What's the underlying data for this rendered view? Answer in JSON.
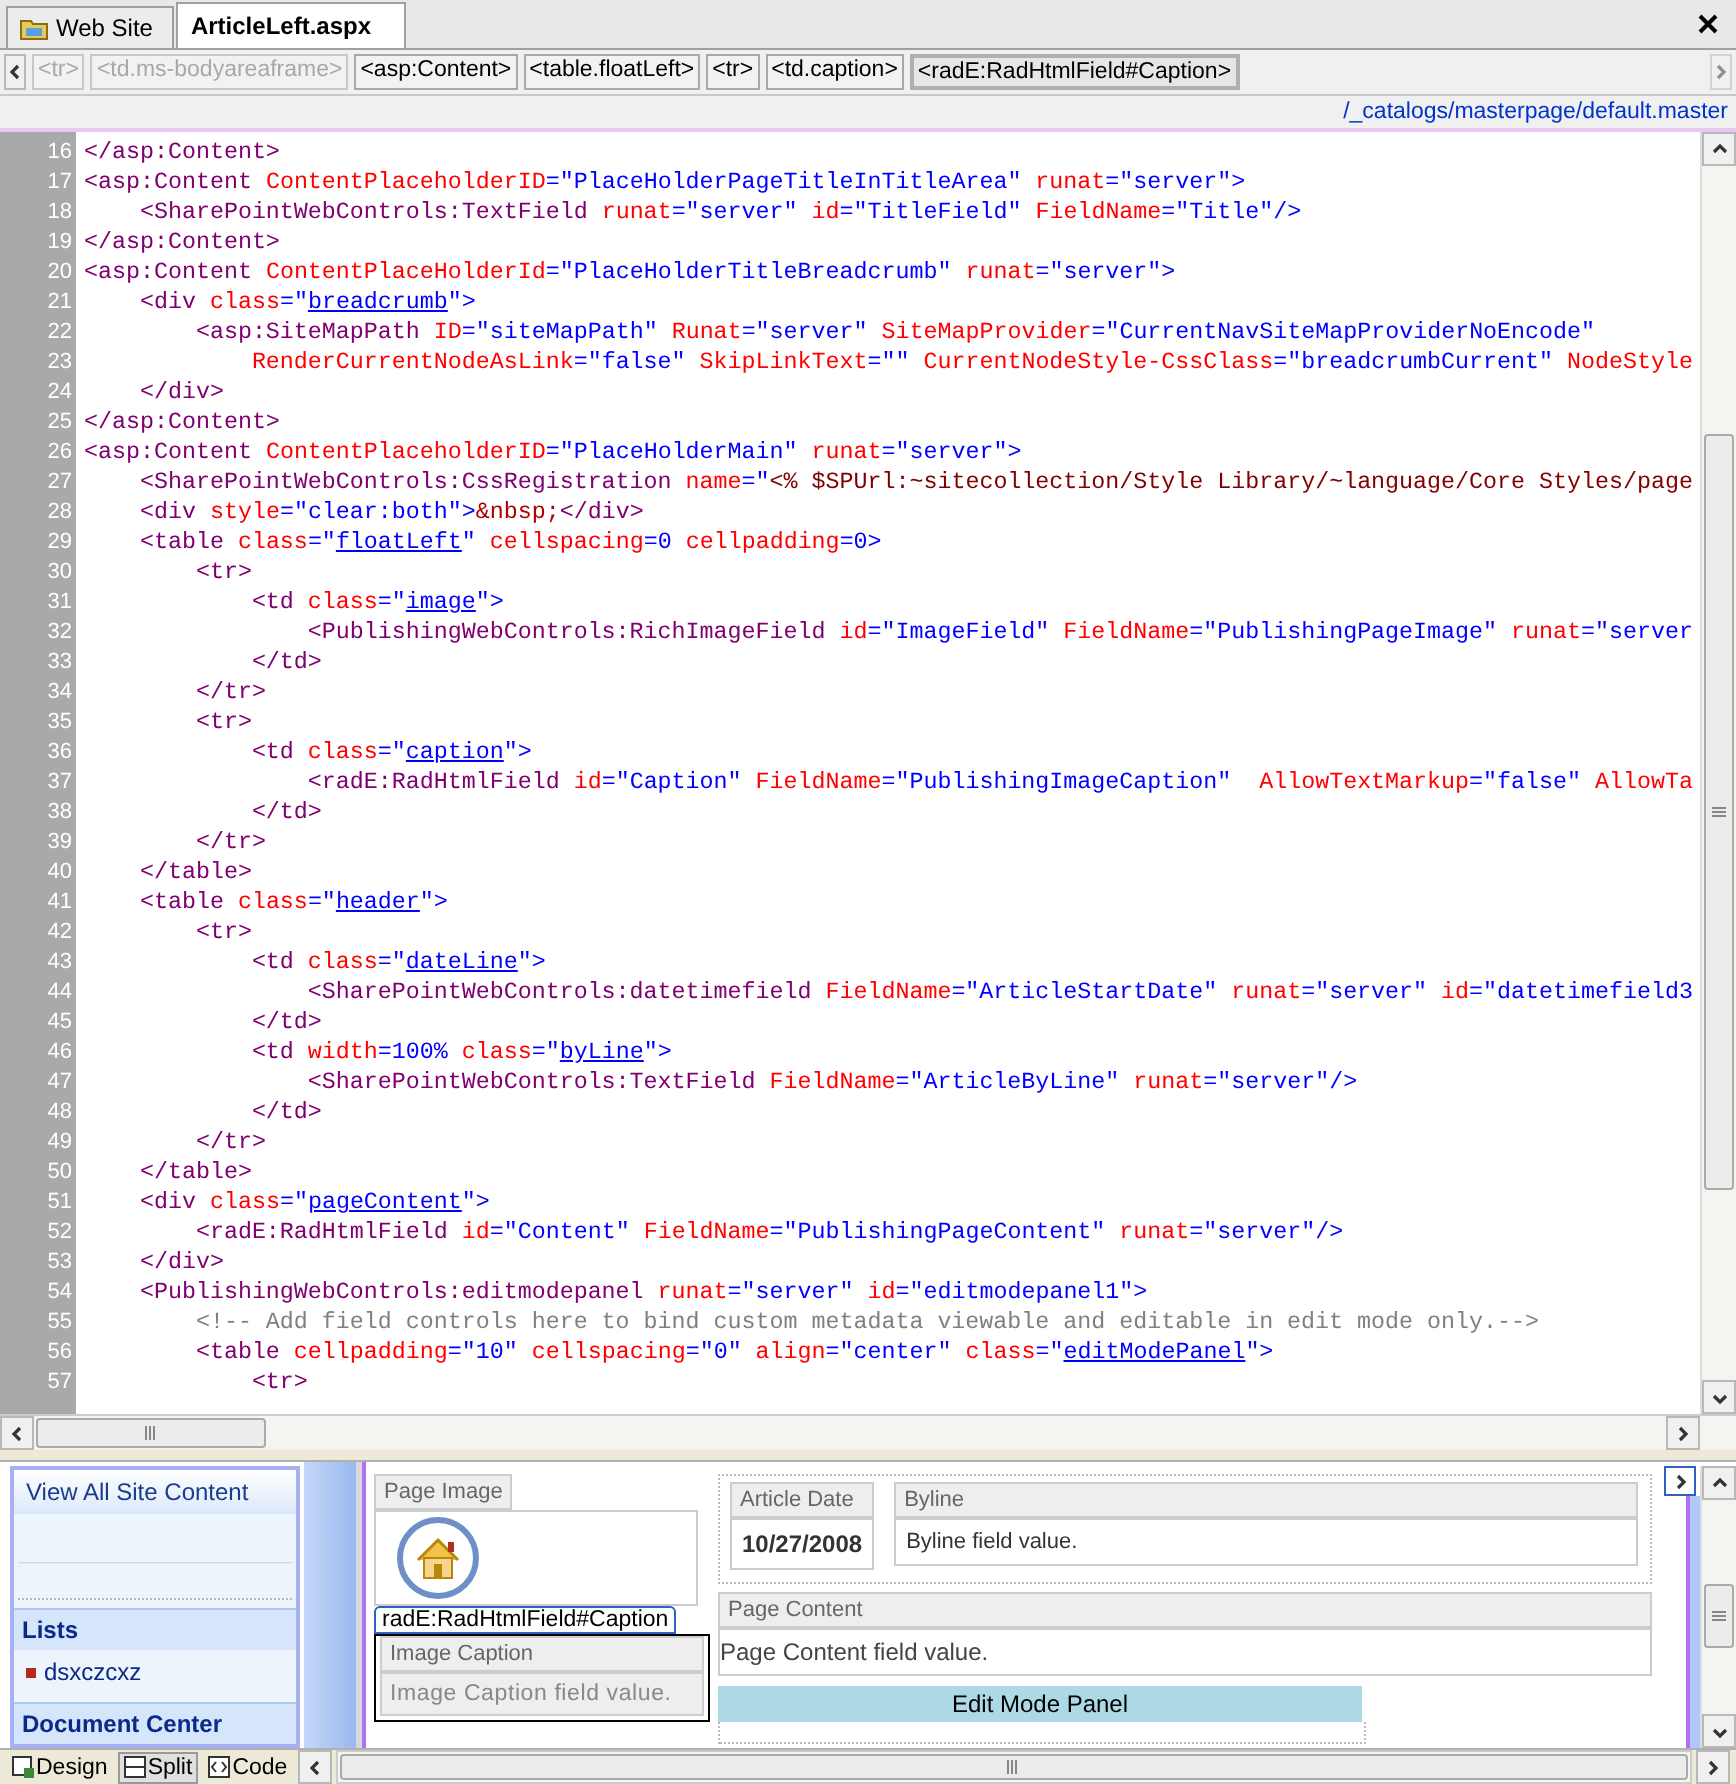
{
  "tabs": [
    {
      "label": "Web Site",
      "selected": false
    },
    {
      "label": "ArticleLeft.aspx",
      "selected": true
    }
  ],
  "breadcrumb": [
    {
      "label": "<tr>",
      "disabled": true,
      "selected": false
    },
    {
      "label": "<td.ms-bodyareaframe>",
      "disabled": true,
      "selected": false
    },
    {
      "label": "<asp:Content>",
      "disabled": false,
      "selected": false
    },
    {
      "label": "<table.floatLeft>",
      "disabled": false,
      "selected": false
    },
    {
      "label": "<tr>",
      "disabled": false,
      "selected": false
    },
    {
      "label": "<td.caption>",
      "disabled": false,
      "selected": false
    },
    {
      "label": "<radE:RadHtmlField#Caption>",
      "disabled": false,
      "selected": true
    }
  ],
  "master_page_link": "/_catalogs/masterpage/default.master",
  "code_lines": [
    {
      "number": "16",
      "tokens": [
        {
          "kind": "tag",
          "text": "</asp:Content>"
        }
      ]
    },
    {
      "number": "17",
      "tokens": [
        {
          "kind": "tag",
          "text": "<asp:Content"
        },
        {
          "kind": "attr",
          "text": " ContentPlaceholderID"
        },
        {
          "kind": "value",
          "text": "=\"PlaceHolderPageTitleInTitleArea\""
        },
        {
          "kind": "attr",
          "text": " runat"
        },
        {
          "kind": "value",
          "text": "=\"server\">"
        }
      ]
    },
    {
      "number": "18",
      "tokens": [
        {
          "kind": "tag",
          "text": "    <SharePointWebControls:TextField"
        },
        {
          "kind": "attr",
          "text": " runat"
        },
        {
          "kind": "value",
          "text": "=\"server\""
        },
        {
          "kind": "attr",
          "text": " id"
        },
        {
          "kind": "value",
          "text": "=\"TitleField\""
        },
        {
          "kind": "attr",
          "text": " FieldName"
        },
        {
          "kind": "value",
          "text": "=\"Title\"/>"
        }
      ]
    },
    {
      "number": "19",
      "tokens": [
        {
          "kind": "tag",
          "text": "</asp:Content>"
        }
      ]
    },
    {
      "number": "20",
      "tokens": [
        {
          "kind": "tag",
          "text": "<asp:Content"
        },
        {
          "kind": "attr",
          "text": " ContentPlaceHolderId"
        },
        {
          "kind": "value",
          "text": "=\"PlaceHolderTitleBreadcrumb\""
        },
        {
          "kind": "attr",
          "text": " runat"
        },
        {
          "kind": "value",
          "text": "=\"server\">"
        }
      ]
    },
    {
      "number": "21",
      "tokens": [
        {
          "kind": "tag",
          "text": "    <div"
        },
        {
          "kind": "attr",
          "text": " class"
        },
        {
          "kind": "value",
          "text": "=\""
        },
        {
          "kind": "link",
          "text": "breadcrumb"
        },
        {
          "kind": "value",
          "text": "\">"
        }
      ]
    },
    {
      "number": "22",
      "tokens": [
        {
          "kind": "tag",
          "text": "        <asp:SiteMapPath"
        },
        {
          "kind": "attr",
          "text": " ID"
        },
        {
          "kind": "value",
          "text": "=\"siteMapPath\""
        },
        {
          "kind": "attr",
          "text": " Runat"
        },
        {
          "kind": "value",
          "text": "=\"server\""
        },
        {
          "kind": "attr",
          "text": " SiteMapProvider"
        },
        {
          "kind": "value",
          "text": "=\"CurrentNavSiteMapProviderNoEncode\""
        }
      ]
    },
    {
      "number": "23",
      "tokens": [
        {
          "kind": "attr",
          "text": "            RenderCurrentNodeAsLink"
        },
        {
          "kind": "value",
          "text": "=\"false\""
        },
        {
          "kind": "attr",
          "text": " SkipLinkText"
        },
        {
          "kind": "value",
          "text": "=\"\""
        },
        {
          "kind": "attr",
          "text": " CurrentNodeStyle-CssClass"
        },
        {
          "kind": "value",
          "text": "=\"breadcrumbCurrent\""
        },
        {
          "kind": "attr",
          "text": " NodeStyle"
        }
      ]
    },
    {
      "number": "24",
      "tokens": [
        {
          "kind": "tag",
          "text": "    </div>"
        }
      ]
    },
    {
      "number": "25",
      "tokens": [
        {
          "kind": "tag",
          "text": "</asp:Content>"
        }
      ]
    },
    {
      "number": "26",
      "tokens": [
        {
          "kind": "tag",
          "text": "<asp:Content"
        },
        {
          "kind": "attr",
          "text": " ContentPlaceholderID"
        },
        {
          "kind": "value",
          "text": "=\"PlaceHolderMain\""
        },
        {
          "kind": "attr",
          "text": " runat"
        },
        {
          "kind": "value",
          "text": "=\"server\">"
        }
      ]
    },
    {
      "number": "27",
      "tokens": [
        {
          "kind": "tag",
          "text": "    <SharePointWebControls:CssRegistration"
        },
        {
          "kind": "attr",
          "text": " name"
        },
        {
          "kind": "value",
          "text": "=\""
        },
        {
          "kind": "script",
          "text": "<% $SPUrl:~sitecollection/Style Library/~language/Core Styles/page"
        }
      ]
    },
    {
      "number": "28",
      "tokens": [
        {
          "kind": "tag",
          "text": "    <div"
        },
        {
          "kind": "attr",
          "text": " style"
        },
        {
          "kind": "value",
          "text": "=\"clear:both\">"
        },
        {
          "kind": "entity",
          "text": "&nbsp;"
        },
        {
          "kind": "tag",
          "text": "</div>"
        }
      ]
    },
    {
      "number": "29",
      "tokens": [
        {
          "kind": "tag",
          "text": "    <table"
        },
        {
          "kind": "attr",
          "text": " class"
        },
        {
          "kind": "value",
          "text": "=\""
        },
        {
          "kind": "link",
          "text": "floatLeft"
        },
        {
          "kind": "value",
          "text": "\""
        },
        {
          "kind": "attr",
          "text": " cellspacing"
        },
        {
          "kind": "value",
          "text": "=0"
        },
        {
          "kind": "attr",
          "text": " cellpadding"
        },
        {
          "kind": "value",
          "text": "=0>"
        }
      ]
    },
    {
      "number": "30",
      "tokens": [
        {
          "kind": "tag",
          "text": "        <tr>"
        }
      ]
    },
    {
      "number": "31",
      "tokens": [
        {
          "kind": "tag",
          "text": "            <td"
        },
        {
          "kind": "attr",
          "text": " class"
        },
        {
          "kind": "value",
          "text": "=\""
        },
        {
          "kind": "link",
          "text": "image"
        },
        {
          "kind": "value",
          "text": "\">"
        }
      ]
    },
    {
      "number": "32",
      "tokens": [
        {
          "kind": "tag",
          "text": "                <PublishingWebControls:RichImageField"
        },
        {
          "kind": "attr",
          "text": " id"
        },
        {
          "kind": "value",
          "text": "=\"ImageField\""
        },
        {
          "kind": "attr",
          "text": " FieldName"
        },
        {
          "kind": "value",
          "text": "=\"PublishingPageImage\""
        },
        {
          "kind": "attr",
          "text": " runat"
        },
        {
          "kind": "value",
          "text": "=\"server"
        }
      ]
    },
    {
      "number": "33",
      "tokens": [
        {
          "kind": "tag",
          "text": "            </td>"
        }
      ]
    },
    {
      "number": "34",
      "tokens": [
        {
          "kind": "tag",
          "text": "        </tr>"
        }
      ]
    },
    {
      "number": "35",
      "tokens": [
        {
          "kind": "tag",
          "text": "        <tr>"
        }
      ]
    },
    {
      "number": "36",
      "tokens": [
        {
          "kind": "tag",
          "text": "            <td"
        },
        {
          "kind": "attr",
          "text": " class"
        },
        {
          "kind": "value",
          "text": "=\""
        },
        {
          "kind": "link",
          "text": "caption"
        },
        {
          "kind": "value",
          "text": "\">"
        }
      ]
    },
    {
      "number": "37",
      "tokens": [
        {
          "kind": "tag",
          "text": "                <radE:RadHtmlField"
        },
        {
          "kind": "attr",
          "text": " id"
        },
        {
          "kind": "value",
          "text": "=\"Caption\""
        },
        {
          "kind": "attr",
          "text": " FieldName"
        },
        {
          "kind": "value",
          "text": "=\"PublishingImageCaption\""
        },
        {
          "kind": "attr",
          "text": "  AllowTextMarkup"
        },
        {
          "kind": "value",
          "text": "=\"false\""
        },
        {
          "kind": "attr",
          "text": " AllowTa"
        }
      ]
    },
    {
      "number": "38",
      "tokens": [
        {
          "kind": "tag",
          "text": "            </td>"
        }
      ]
    },
    {
      "number": "39",
      "tokens": [
        {
          "kind": "tag",
          "text": "        </tr>"
        }
      ]
    },
    {
      "number": "40",
      "tokens": [
        {
          "kind": "tag",
          "text": "    </table>"
        }
      ]
    },
    {
      "number": "41",
      "tokens": [
        {
          "kind": "tag",
          "text": "    <table"
        },
        {
          "kind": "attr",
          "text": " class"
        },
        {
          "kind": "value",
          "text": "=\""
        },
        {
          "kind": "link",
          "text": "header"
        },
        {
          "kind": "value",
          "text": "\">"
        }
      ]
    },
    {
      "number": "42",
      "tokens": [
        {
          "kind": "tag",
          "text": "        <tr>"
        }
      ]
    },
    {
      "number": "43",
      "tokens": [
        {
          "kind": "tag",
          "text": "            <td"
        },
        {
          "kind": "attr",
          "text": " class"
        },
        {
          "kind": "value",
          "text": "=\""
        },
        {
          "kind": "link",
          "text": "dateLine"
        },
        {
          "kind": "value",
          "text": "\">"
        }
      ]
    },
    {
      "number": "44",
      "tokens": [
        {
          "kind": "tag",
          "text": "                <SharePointWebControls:datetimefield"
        },
        {
          "kind": "attr",
          "text": " FieldName"
        },
        {
          "kind": "value",
          "text": "=\"ArticleStartDate\""
        },
        {
          "kind": "attr",
          "text": " runat"
        },
        {
          "kind": "value",
          "text": "=\"server\""
        },
        {
          "kind": "attr",
          "text": " id"
        },
        {
          "kind": "value",
          "text": "=\"datetimefield3"
        }
      ]
    },
    {
      "number": "45",
      "tokens": [
        {
          "kind": "tag",
          "text": "            </td>"
        }
      ]
    },
    {
      "number": "46",
      "tokens": [
        {
          "kind": "tag",
          "text": "            <td"
        },
        {
          "kind": "attr",
          "text": " width"
        },
        {
          "kind": "value",
          "text": "=100%"
        },
        {
          "kind": "attr",
          "text": " class"
        },
        {
          "kind": "value",
          "text": "=\""
        },
        {
          "kind": "link",
          "text": "byLine"
        },
        {
          "kind": "value",
          "text": "\">"
        }
      ]
    },
    {
      "number": "47",
      "tokens": [
        {
          "kind": "tag",
          "text": "                <SharePointWebControls:TextField"
        },
        {
          "kind": "attr",
          "text": " FieldName"
        },
        {
          "kind": "value",
          "text": "=\"ArticleByLine\""
        },
        {
          "kind": "attr",
          "text": " runat"
        },
        {
          "kind": "value",
          "text": "=\"server\"/>"
        }
      ]
    },
    {
      "number": "48",
      "tokens": [
        {
          "kind": "tag",
          "text": "            </td>"
        }
      ]
    },
    {
      "number": "49",
      "tokens": [
        {
          "kind": "tag",
          "text": "        </tr>"
        }
      ]
    },
    {
      "number": "50",
      "tokens": [
        {
          "kind": "tag",
          "text": "    </table>"
        }
      ]
    },
    {
      "number": "51",
      "tokens": [
        {
          "kind": "tag",
          "text": "    <div"
        },
        {
          "kind": "attr",
          "text": " class"
        },
        {
          "kind": "value",
          "text": "=\""
        },
        {
          "kind": "link",
          "text": "pageContent"
        },
        {
          "kind": "value",
          "text": "\">"
        }
      ]
    },
    {
      "number": "52",
      "tokens": [
        {
          "kind": "tag",
          "text": "        <radE:RadHtmlField"
        },
        {
          "kind": "attr",
          "text": " id"
        },
        {
          "kind": "value",
          "text": "=\"Content\""
        },
        {
          "kind": "attr",
          "text": " FieldName"
        },
        {
          "kind": "value",
          "text": "=\"PublishingPageContent\""
        },
        {
          "kind": "attr",
          "text": " runat"
        },
        {
          "kind": "value",
          "text": "=\"server\"/>"
        }
      ]
    },
    {
      "number": "53",
      "tokens": [
        {
          "kind": "tag",
          "text": "    </div>"
        }
      ]
    },
    {
      "number": "54",
      "tokens": [
        {
          "kind": "tag",
          "text": "    <PublishingWebControls:editmodepanel"
        },
        {
          "kind": "attr",
          "text": " runat"
        },
        {
          "kind": "value",
          "text": "=\"server\""
        },
        {
          "kind": "attr",
          "text": " id"
        },
        {
          "kind": "value",
          "text": "=\"editmodepanel1\">"
        }
      ]
    },
    {
      "number": "55",
      "tokens": [
        {
          "kind": "comment",
          "text": "        <!-- Add field controls here to bind custom metadata viewable and editable in edit mode only.-->"
        }
      ]
    },
    {
      "number": "56",
      "tokens": [
        {
          "kind": "tag",
          "text": "        <table"
        },
        {
          "kind": "attr",
          "text": " cellpadding"
        },
        {
          "kind": "value",
          "text": "=\"10\""
        },
        {
          "kind": "attr",
          "text": " cellspacing"
        },
        {
          "kind": "value",
          "text": "=\"0\""
        },
        {
          "kind": "attr",
          "text": " align"
        },
        {
          "kind": "value",
          "text": "=\"center\""
        },
        {
          "kind": "attr",
          "text": " class"
        },
        {
          "kind": "value",
          "text": "=\""
        },
        {
          "kind": "link",
          "text": "editModePanel"
        },
        {
          "kind": "value",
          "text": "\">"
        }
      ]
    },
    {
      "number": "57",
      "tokens": [
        {
          "kind": "tag",
          "text": "            <tr>"
        }
      ]
    }
  ],
  "design": {
    "sidebar": {
      "link": "View All Site Content",
      "sections": [
        {
          "heading": "Lists",
          "items": [
            "dsxczcxz"
          ]
        },
        {
          "heading": "Document Center"
        }
      ]
    },
    "page_image": {
      "label": "Page Image"
    },
    "selected_tag": "radE:RadHtmlField#Caption",
    "image_caption": {
      "label": "Image Caption",
      "value": "Image Caption field value."
    },
    "article_date": {
      "label": "Article Date",
      "value": "10/27/2008"
    },
    "byline": {
      "label": "Byline",
      "value": "Byline field value."
    },
    "page_content": {
      "label": "Page Content",
      "value": "Page Content field value."
    },
    "edit_mode_panel": "Edit Mode Panel"
  },
  "view_buttons": [
    {
      "label": "Design",
      "kind": "design",
      "selected": false
    },
    {
      "label": "Split",
      "kind": "split",
      "selected": true
    },
    {
      "label": "Code",
      "kind": "code",
      "selected": false
    }
  ]
}
